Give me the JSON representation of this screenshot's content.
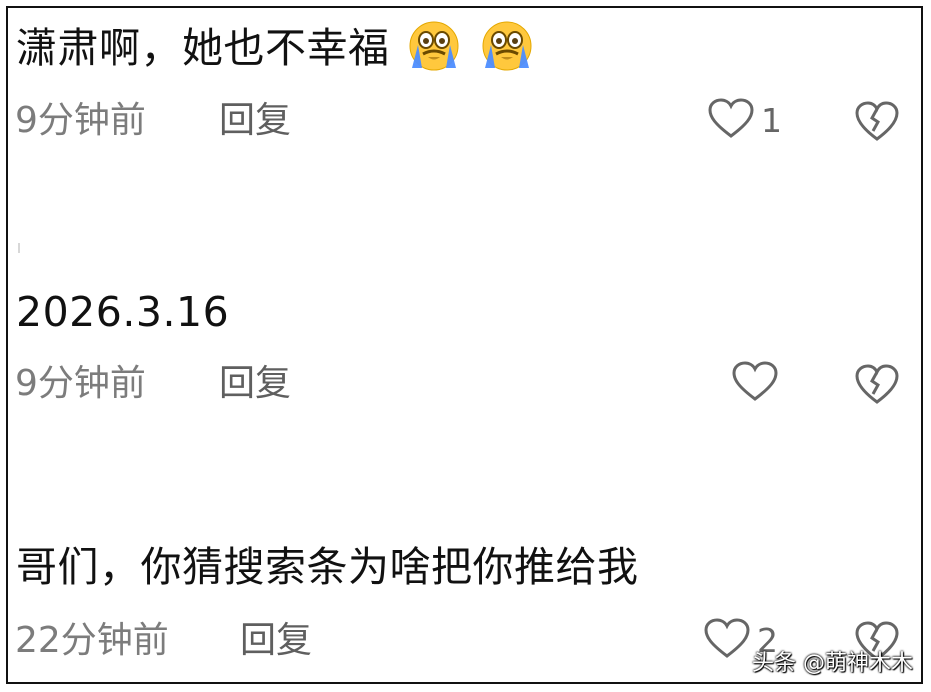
{
  "comments": [
    {
      "text": "潇肃啊，她也不幸福",
      "emojis": [
        "crying-emoji",
        "crying-emoji"
      ],
      "time": "9分钟前",
      "reply_label": "回复",
      "like_count": "1",
      "liked": false
    },
    {
      "text": "2026.3.16",
      "emojis": [],
      "time": "9分钟前",
      "reply_label": "回复",
      "like_count": "",
      "liked": false
    },
    {
      "text": "哥们，你猜搜索条为啥把你推给我",
      "emojis": [],
      "time": "22分钟前",
      "reply_label": "回复",
      "like_count": "2",
      "liked": false
    }
  ],
  "watermark": {
    "text": "头条 @萌神木木"
  },
  "colors": {
    "text": "#111111",
    "meta": "#7c7c7c",
    "icon_stroke": "#666666",
    "emoji_face": "#ffc83d",
    "emoji_tears": "#4d8dff"
  }
}
